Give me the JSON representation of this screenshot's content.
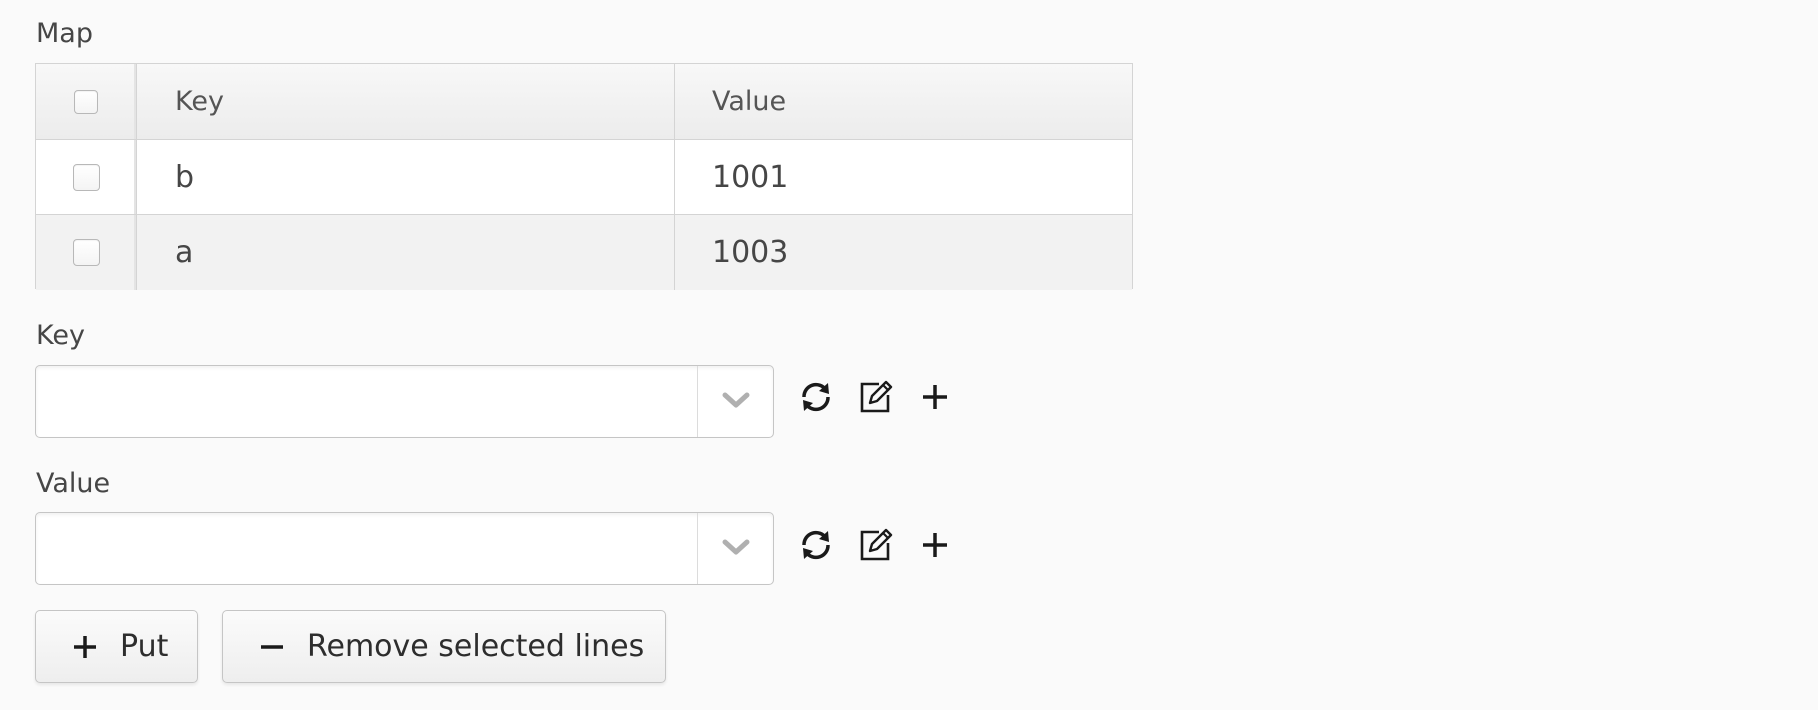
{
  "map": {
    "label": "Map",
    "columns": {
      "key": "Key",
      "value": "Value"
    },
    "rows": [
      {
        "key": "b",
        "value": "1001",
        "selected": false
      },
      {
        "key": "a",
        "value": "1003",
        "selected": false
      }
    ]
  },
  "key_field": {
    "label": "Key",
    "value": ""
  },
  "value_field": {
    "label": "Value",
    "value": ""
  },
  "actions": {
    "put_label": "Put",
    "remove_label": "Remove selected lines"
  },
  "icons": {
    "refresh": "refresh-icon",
    "edit": "edit-icon",
    "add": "plus-icon",
    "dropdown": "chevron-down-icon",
    "minus": "minus-icon"
  },
  "colors": {
    "background": "#fafafa",
    "border": "#d4d4d4",
    "text": "#464646",
    "chevron": "#b0b0b0"
  }
}
